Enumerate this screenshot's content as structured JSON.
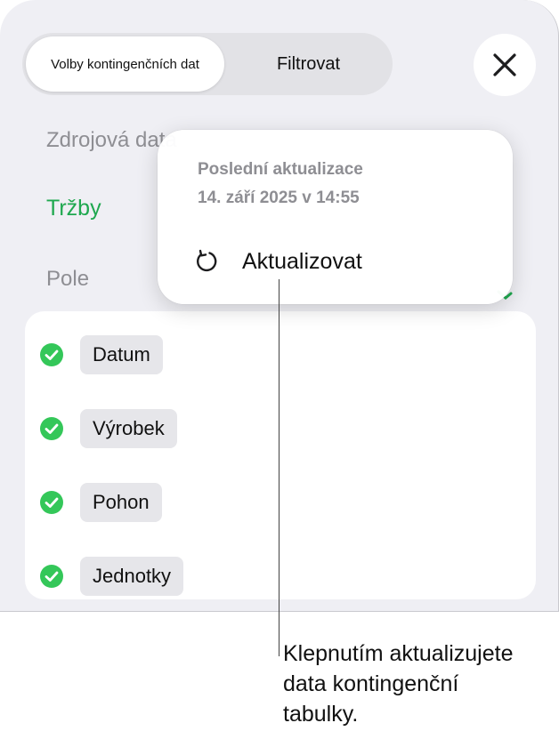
{
  "segmented": {
    "options": [
      {
        "label": "Volby kontingenčních dat",
        "selected": true
      },
      {
        "label": "Filtrovat",
        "selected": false
      }
    ]
  },
  "close_icon": "close-icon",
  "sections": {
    "source_label": "Zdrojová data",
    "source_value": "Tržby",
    "fields_label": "Pole"
  },
  "fields": [
    {
      "label": "Datum",
      "checked": true
    },
    {
      "label": "Výrobek",
      "checked": true
    },
    {
      "label": "Pohon",
      "checked": true
    },
    {
      "label": "Jednotky",
      "checked": true
    }
  ],
  "popover": {
    "title": "Poslední aktualizace",
    "date": "14. září 2025 v 14:55",
    "action_label": "Aktualizovat",
    "action_icon": "refresh-icon"
  },
  "callout": {
    "lines": [
      "Klepnutím aktualizujete",
      "data kontingenční",
      "tabulky."
    ]
  },
  "colors": {
    "accent_green": "#1fa84f",
    "check_green": "#34c759",
    "sheet_bg": "#efeff4"
  }
}
